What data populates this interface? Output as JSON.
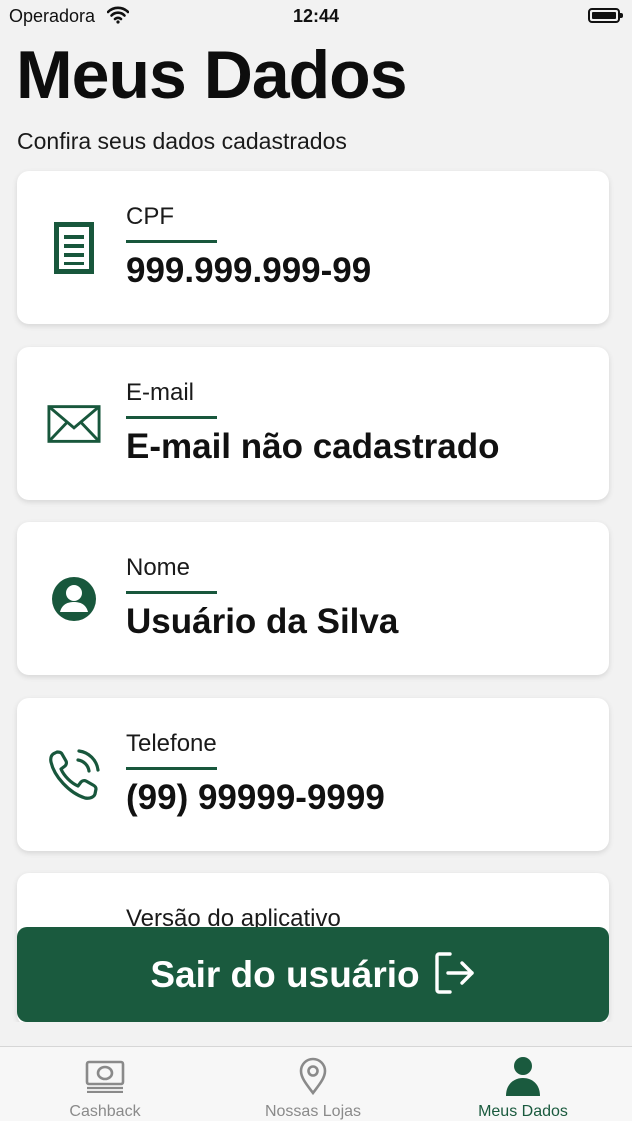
{
  "status_bar": {
    "carrier": "Operadora",
    "time": "12:44"
  },
  "header": {
    "title": "Meus Dados",
    "subtitle": "Confira seus dados cadastrados"
  },
  "cards": [
    {
      "label": "CPF",
      "value": "999.999.999-99",
      "icon": "document-icon"
    },
    {
      "label": "E-mail",
      "value": "E-mail não cadastrado",
      "icon": "envelope-icon"
    },
    {
      "label": "Nome",
      "value": "Usuário da Silva",
      "icon": "user-circle-icon"
    },
    {
      "label": "Telefone",
      "value": "(99) 99999-9999",
      "icon": "phone-ringing-icon"
    },
    {
      "label": "Versão do aplicativo",
      "value": "",
      "icon": "info-icon"
    }
  ],
  "logout": {
    "label": "Sair do usuário",
    "icon": "logout-icon"
  },
  "tabs": [
    {
      "label": "Cashback",
      "icon": "banknote-icon",
      "active": false
    },
    {
      "label": "Nossas Lojas",
      "icon": "map-pin-icon",
      "active": false
    },
    {
      "label": "Meus Dados",
      "icon": "person-icon",
      "active": true
    }
  ],
  "colors": {
    "accent": "#1a5a3e",
    "background": "#f2f2f2",
    "card": "#ffffff",
    "inactive_tab": "#8a8a8a"
  }
}
